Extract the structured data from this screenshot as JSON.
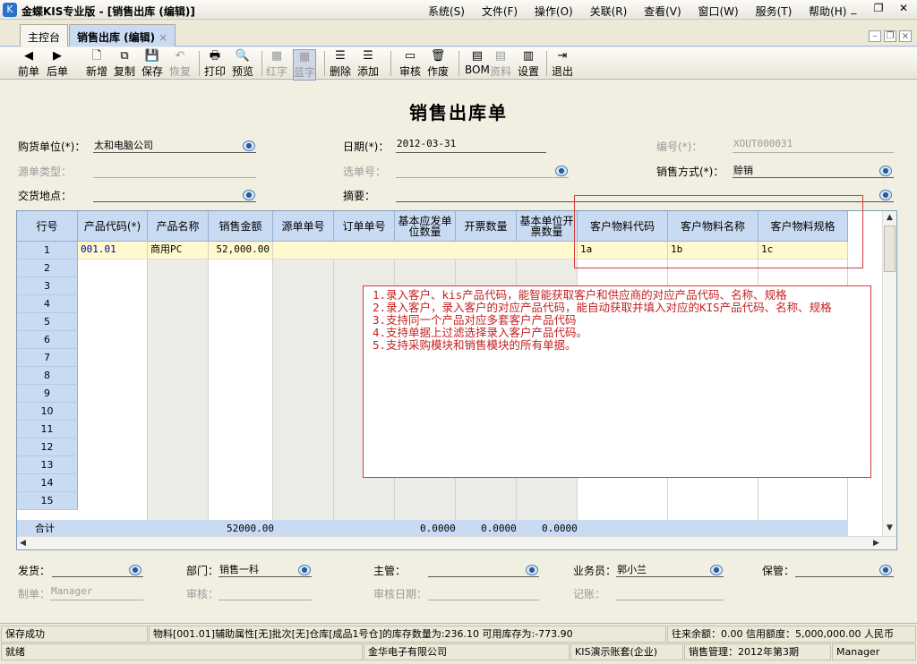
{
  "window": {
    "title": "金蝶KIS专业版 - [销售出库 (编辑)]",
    "menus": [
      "系统(S)",
      "文件(F)",
      "操作(O)",
      "关联(R)",
      "查看(V)",
      "窗口(W)",
      "服务(T)",
      "帮助(H)"
    ],
    "controls": [
      "_",
      "❐",
      "✕"
    ]
  },
  "tabs": [
    {
      "label": "主控台"
    },
    {
      "label": "销售出库 (编辑)",
      "close": "×"
    }
  ],
  "toolbar": [
    {
      "label": "前单",
      "icon": "◀"
    },
    {
      "label": "后单",
      "icon": "▶"
    },
    {
      "label": "新增",
      "icon": "🗋"
    },
    {
      "label": "复制",
      "icon": "⧉"
    },
    {
      "label": "保存",
      "icon": "💾"
    },
    {
      "label": "恢复",
      "icon": "↶"
    },
    {
      "label": "打印",
      "icon": "🖶"
    },
    {
      "label": "预览",
      "icon": "🔍"
    },
    {
      "label": "红字",
      "icon": "▦"
    },
    {
      "label": "蓝字",
      "icon": "▦"
    },
    {
      "label": "删除",
      "icon": "☰"
    },
    {
      "label": "添加",
      "icon": "☰"
    },
    {
      "label": "审核",
      "icon": "▭"
    },
    {
      "label": "作废",
      "icon": "🗑"
    },
    {
      "label": "BOM",
      "icon": "▤"
    },
    {
      "label": "资料",
      "icon": "▤"
    },
    {
      "label": "设置",
      "icon": "▥"
    },
    {
      "label": "退出",
      "icon": "⇥"
    }
  ],
  "form": {
    "title": "销售出库单",
    "customer_label": "购货单位(*)：",
    "customer_value": "太和电脑公司",
    "date_label": "日期(*)：",
    "date_value": "2012-03-31",
    "number_label": "编号(*)：",
    "number_value": "XOUT000031",
    "source_type_label": "源单类型：",
    "select_no_label": "选单号：",
    "sale_method_label": "销售方式(*)：",
    "sale_method_value": "赊销",
    "delivery_label": "交货地点：",
    "summary_label": "摘要："
  },
  "grid": {
    "columns": [
      "行号",
      "产品代码(*)",
      "产品名称",
      "销售金额",
      "源单单号",
      "订单单号",
      "基本应发单位数量",
      "开票数量",
      "基本单位开票数量",
      "客户物料代码",
      "客户物料名称",
      "客户物料规格"
    ],
    "row_numbers": [
      "1",
      "2",
      "3",
      "4",
      "5",
      "6",
      "7",
      "8",
      "9",
      "10",
      "11",
      "12",
      "13",
      "14",
      "15"
    ],
    "row1": {
      "code": "001.01",
      "name": "商用PC",
      "amount": "52,000.00",
      "cust_code": "1a",
      "cust_name": "1b",
      "cust_spec": "1c"
    },
    "total": {
      "label": "合计",
      "amount": "52000.00",
      "qty": "0.0000",
      "invoice": "0.0000",
      "base_invoice": "0.0000"
    }
  },
  "note": [
    "1.录入客户、kis产品代码，能智能获取客户和供应商的对应产品代码、名称、规格",
    "2.录入客户，录入客户的对应产品代码，能自动获取并填入对应的KIS产品代码、名称、规格",
    "3.支持同一个产品对应多套客户产品代码",
    "4.支持单据上过滤选择录入客户产品代码。",
    "5.支持采购模块和销售模块的所有单据。"
  ],
  "footer": {
    "ship_label": "发货：",
    "dept_label": "部门：",
    "dept_value": "销售一科",
    "manager_label": "主管：",
    "salesman_label": "业务员：",
    "salesman_value": "郭小兰",
    "keeper_label": "保管：",
    "maker_label": "制单：",
    "maker_value": "Manager",
    "audit_label": "审核：",
    "audit_date_label": "审核日期：",
    "posting_label": "记账："
  },
  "status": {
    "msg": "保存成功",
    "stock": "物料[001.01]辅助属性[无]批次[无]仓库[成品1号仓]的库存数量为:236.10    可用库存为:-773.90",
    "balance": "往来余额：0.00  信用额度：5,000,000.00 人民币",
    "ready": "就绪",
    "company": "金华电子有限公司",
    "account": "KIS演示账套(企业)",
    "period": "销售管理：2012年第3期",
    "user": "Manager"
  }
}
